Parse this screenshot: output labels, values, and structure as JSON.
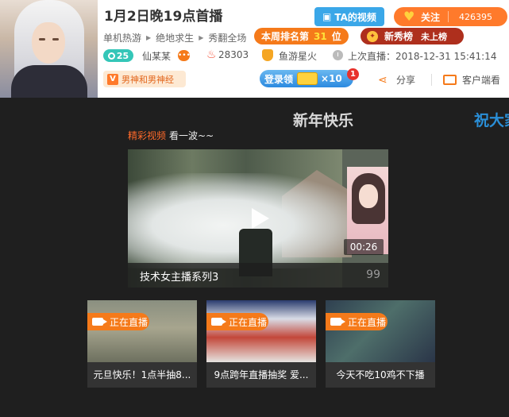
{
  "header": {
    "title": "1月2日晚19点首播",
    "ta_video": "TA的视频",
    "follow": {
      "label": "关注",
      "count": "426395"
    },
    "crumbs": [
      "单机热游",
      "绝地求生",
      "秀翻全场"
    ],
    "rank": {
      "prefix": "本周排名第",
      "number": "31",
      "suffix": "位"
    },
    "new_star": {
      "label": "新秀榜",
      "status": "未上榜"
    },
    "level": "25",
    "streamer": "仙某某",
    "heat": "28303",
    "guild": "鱼游星火",
    "last_live": "上次直播：2018-12-31 15:41:14",
    "tag": "男神和男神经",
    "login": {
      "label": "登录领",
      "count": "×10",
      "badge": "1"
    },
    "share": "分享",
    "client": "客户端看"
  },
  "main": {
    "heading": "新年快乐",
    "side_heading": "祝大家",
    "sub_a": "精彩视频",
    "sub_b": "看一波~~",
    "video": {
      "title": "技术女主播系列3",
      "duration": "00:26",
      "count": "99"
    },
    "cards": [
      {
        "live": "正在直播",
        "caption": "元旦快乐！1点半抽8..."
      },
      {
        "live": "正在直播",
        "caption": "9点跨年直播抽奖 爱..."
      },
      {
        "live": "正在直播",
        "caption": "今天不吃10鸡不下播"
      }
    ]
  },
  "colors": {
    "accent": "#f57a1a",
    "blue": "#3aa7e8",
    "dark_bg": "#1f1f1f"
  }
}
